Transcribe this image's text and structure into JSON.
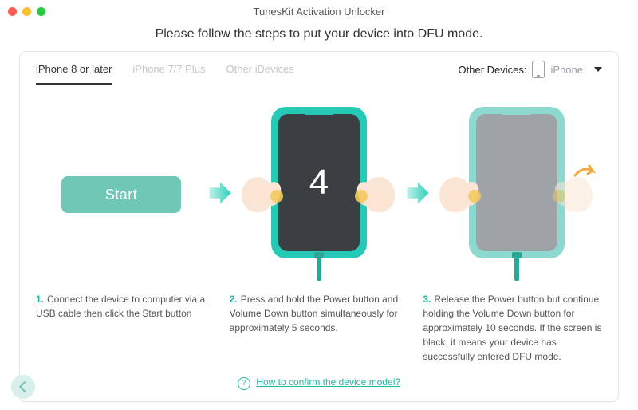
{
  "window": {
    "title": "TunesKit Activation Unlocker"
  },
  "subtitle": "Please follow the steps to put your device into DFU mode.",
  "tabs": [
    "iPhone 8 or later",
    "iPhone 7/7 Plus",
    "Other iDevices"
  ],
  "active_tab": 0,
  "other_devices": {
    "label": "Other Devices:",
    "selected": "iPhone"
  },
  "start_label": "Start",
  "countdown": "4",
  "captions": [
    {
      "num": "1.",
      "text": "Connect the device to computer via a USB cable then click the Start button"
    },
    {
      "num": "2.",
      "text": "Press and hold the Power button and Volume Down button simultaneously for approximately 5 seconds."
    },
    {
      "num": "3.",
      "text": "Release the Power button but continue holding the Volume Down button for approximately 10 seconds. If the screen is black, it means your device has successfully entered DFU mode."
    }
  ],
  "help_link": "How to confirm the device model?",
  "colors": {
    "accent": "#1fb9a4"
  }
}
